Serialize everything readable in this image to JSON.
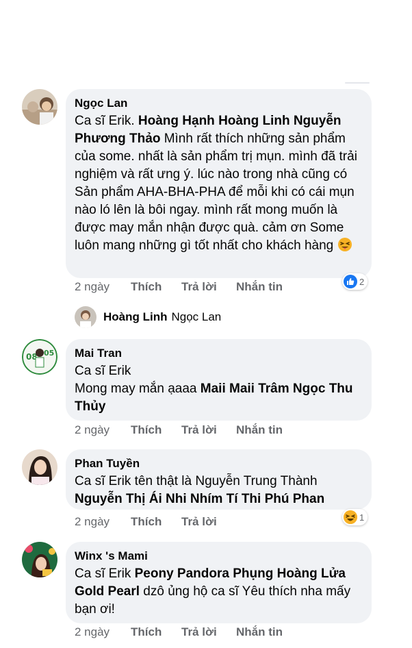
{
  "comments": [
    {
      "author": "Ngọc Lan",
      "segments": [
        {
          "text": "Ca sĩ Erik. ",
          "bold": false
        },
        {
          "text": "Hoàng Hạnh Hoàng Linh Nguyễn Phương Thảo",
          "bold": true
        },
        {
          "text": " Mình rất thích những sản phẩm của some. nhất là sản phẩm trị mụn. mình đã trải nghiệm và rất ưng ý. lúc nào trong nhà cũng có Sản phẩm AHA-BHA-PHA để mỗi khi có cái mụn nào ló lên là bôi ngay. mình rất mong muốn là được may mắn nhận được quà. cảm ơn Some luôn mang những gì tốt nhất cho khách hàng",
          "bold": false
        }
      ],
      "time": "2 ngày",
      "like": "Thích",
      "reply": "Trả lời",
      "message": "Nhắn tin",
      "reaction": {
        "icon": "like-icon",
        "count": "2"
      }
    },
    {
      "author": "Mai Tran",
      "lines": [
        "Ca sĩ Erik"
      ],
      "segments": [
        {
          "text": "Mong may mắn ạaaa ",
          "bold": false
        },
        {
          "text": "Maii Maii Trâm Ngọc Thu Thủy",
          "bold": true
        }
      ],
      "time": "2 ngày",
      "like": "Thích",
      "reply": "Trả lời",
      "message": "Nhắn tin"
    },
    {
      "author": "Phan Tuyền",
      "lines": [
        "Ca sĩ Erik tên thật là Nguyễn Trung Thành"
      ],
      "segments": [
        {
          "text": "Nguyễn Thị Ái Nhi Nhím Tí Thi Phú Phan",
          "bold": true
        }
      ],
      "time": "2 ngày",
      "like": "Thích",
      "reply": "Trả lời",
      "reaction": {
        "icon": "haha-icon",
        "count": "1"
      }
    },
    {
      "author": "Winx 's Mami",
      "segments": [
        {
          "text": "Ca sĩ Erik ",
          "bold": false
        },
        {
          "text": "Peony Pandora Phụng Hoàng Lửa Gold Pearl",
          "bold": true
        },
        {
          "text": " dzô ủng hộ ca sĩ  Yêu thích nha mấy bạn ơi!",
          "bold": false
        }
      ],
      "time": "2 ngày",
      "like": "Thích",
      "reply": "Trả lời",
      "message": "Nhắn tin"
    }
  ],
  "reply_preview": {
    "name": "Hoàng Linh",
    "text": "Ngọc Lan"
  },
  "colors": {
    "bubble": "#f0f2f5",
    "meta": "#65676b",
    "like_blue": "#1877f2",
    "haha_yellow": "#f7b125"
  }
}
